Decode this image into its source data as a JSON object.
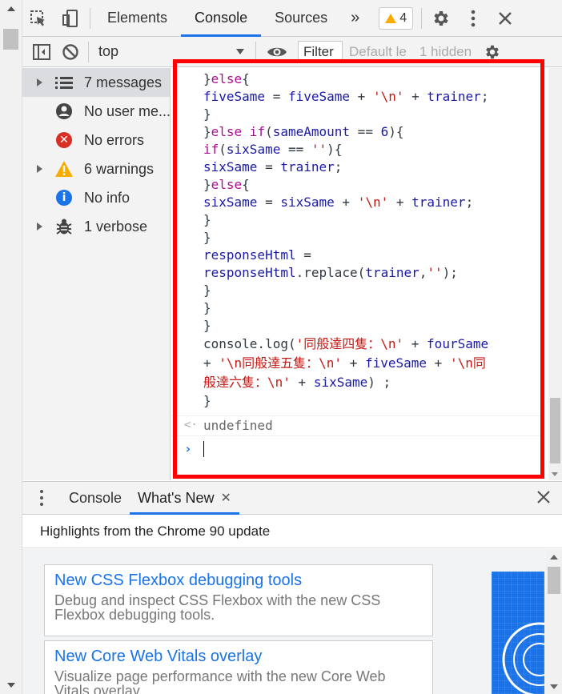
{
  "tabbar": {
    "tabs": [
      {
        "label": "Elements"
      },
      {
        "label": "Console"
      },
      {
        "label": "Sources"
      }
    ],
    "more_label": "»",
    "warning_count": "4"
  },
  "toolbar": {
    "context": "top",
    "filter_label": "Filter",
    "filter_placeholder": "Default le",
    "hidden_label": "1 hidden"
  },
  "sidebar": {
    "items": [
      {
        "label": "7 messages",
        "icon": "list-icon"
      },
      {
        "label": "No user me...",
        "icon": "user-icon"
      },
      {
        "label": "No errors",
        "icon": "error-icon"
      },
      {
        "label": "6 warnings",
        "icon": "warning-icon"
      },
      {
        "label": "No info",
        "icon": "info-icon"
      },
      {
        "label": "1 verbose",
        "icon": "bug-icon"
      }
    ]
  },
  "console": {
    "result": "undefined"
  },
  "drawer": {
    "tabs": [
      {
        "label": "Console"
      },
      {
        "label": "What's New"
      }
    ],
    "close_tab_label": "✕",
    "header": "Highlights from the Chrome 90 update",
    "cards": [
      {
        "title": "New CSS Flexbox debugging tools",
        "desc": "Debug and inspect CSS Flexbox with the new CSS Flexbox debugging tools."
      },
      {
        "title": "New Core Web Vitals overlay",
        "desc": "Visualize page performance with the new Core Web Vitals overlay."
      }
    ]
  },
  "colors": {
    "accent": "#1a73e8",
    "highlight": "#ff0000",
    "warning": "#f9ab00",
    "error": "#d93025"
  }
}
